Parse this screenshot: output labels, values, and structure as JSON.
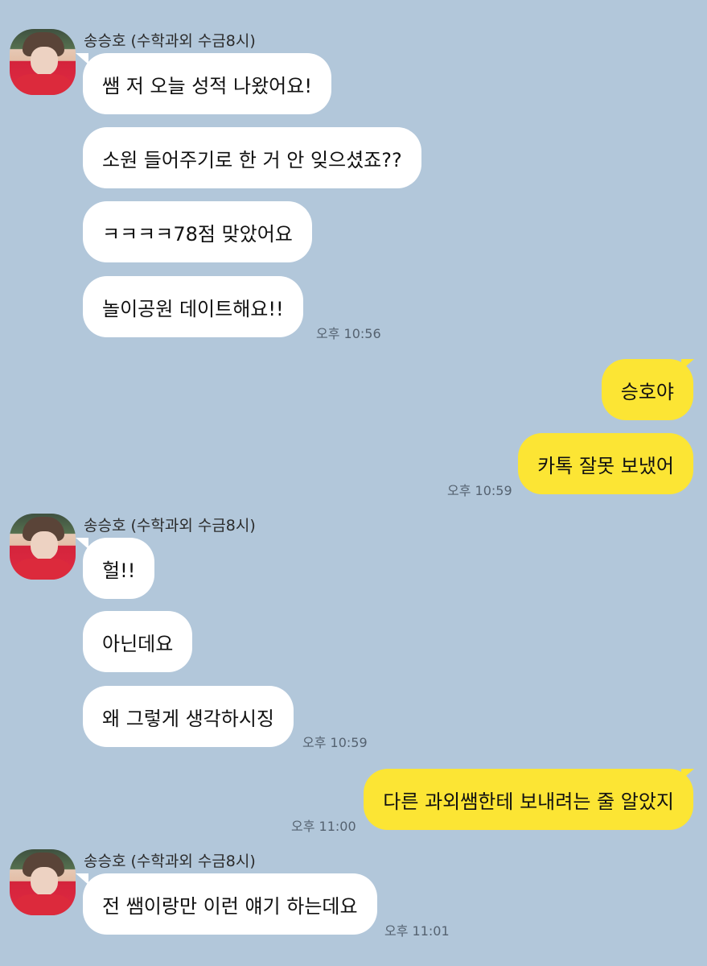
{
  "chat": {
    "contact_name": "송승호 (수학과외 수금8시)",
    "messages": [
      {
        "from": "them",
        "text": "쌤 저 오늘 성적 나왔어요!"
      },
      {
        "from": "them",
        "text": "소원 들어주기로 한 거 안 잊으셨죠??"
      },
      {
        "from": "them",
        "text": "ㅋㅋㅋㅋ78점 맞았어요"
      },
      {
        "from": "them",
        "text": "놀이공원 데이트해요!!",
        "time": "오후 10:56"
      },
      {
        "from": "me",
        "text": "승호야"
      },
      {
        "from": "me",
        "text": "카톡 잘못 보냈어",
        "time": "오후 10:59"
      },
      {
        "from": "them",
        "text": "헐!!"
      },
      {
        "from": "them",
        "text": "아닌데요"
      },
      {
        "from": "them",
        "text": "왜 그렇게 생각하시징",
        "time": "오후 10:59"
      },
      {
        "from": "me",
        "text": "다른 과외쌤한테 보내려는 줄 알았지",
        "time": "오후 11:00"
      },
      {
        "from": "them",
        "text": "전 쌤이랑만 이런 얘기 하는데요",
        "time": "오후 11:01"
      }
    ]
  },
  "colors": {
    "background": "#b2c7da",
    "incoming_bubble": "#ffffff",
    "outgoing_bubble": "#fce534"
  },
  "icons": {
    "avatar": "profile-photo"
  }
}
